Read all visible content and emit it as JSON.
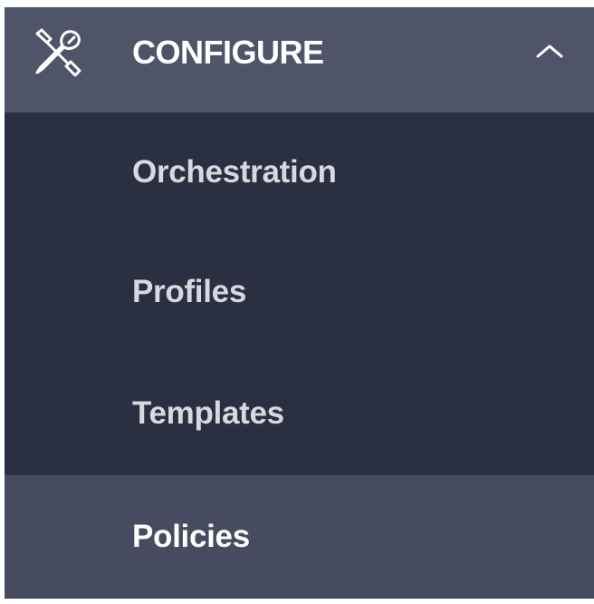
{
  "menu": {
    "section": {
      "icon": "tools-icon",
      "title": "CONFIGURE",
      "expand_icon": "chevron-up-icon",
      "expanded": true
    },
    "items": [
      {
        "label": "Orchestration",
        "active": false
      },
      {
        "label": "Profiles",
        "active": false
      },
      {
        "label": "Templates",
        "active": false
      },
      {
        "label": "Policies",
        "active": true
      }
    ]
  },
  "colors": {
    "panel_background": "#2a2f42",
    "section_header_background": "#505469",
    "active_item_background": "#474b5f",
    "text_primary": "#ffffff",
    "text_secondary": "#d7d9df"
  }
}
